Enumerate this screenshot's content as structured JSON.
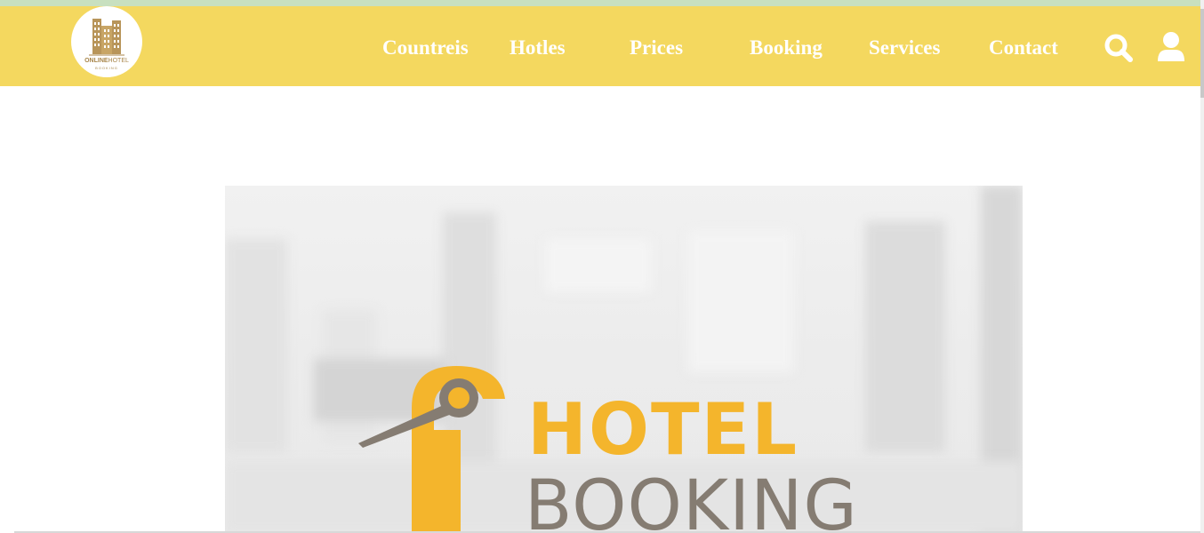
{
  "logo": {
    "brand_bold": "ONLINE",
    "brand_regular": "HOTEL",
    "sub": "BOOKING",
    "icon": "building-icon"
  },
  "nav": {
    "items": [
      {
        "label": "Countreis"
      },
      {
        "label": "Hotles"
      },
      {
        "label": "Prices"
      },
      {
        "label": "Booking"
      },
      {
        "label": "Services"
      },
      {
        "label": "Contact"
      }
    ],
    "search_icon": "search-icon",
    "user_icon": "user-icon"
  },
  "hero": {
    "line1": "HOTEL",
    "line2": "BOOKING",
    "icon": "door-hanger-icon"
  },
  "colors": {
    "navbar": "#f4d85f",
    "accent_orange": "#f4b52c",
    "gray_text": "#857c72",
    "logo_gold": "#a8864a"
  }
}
